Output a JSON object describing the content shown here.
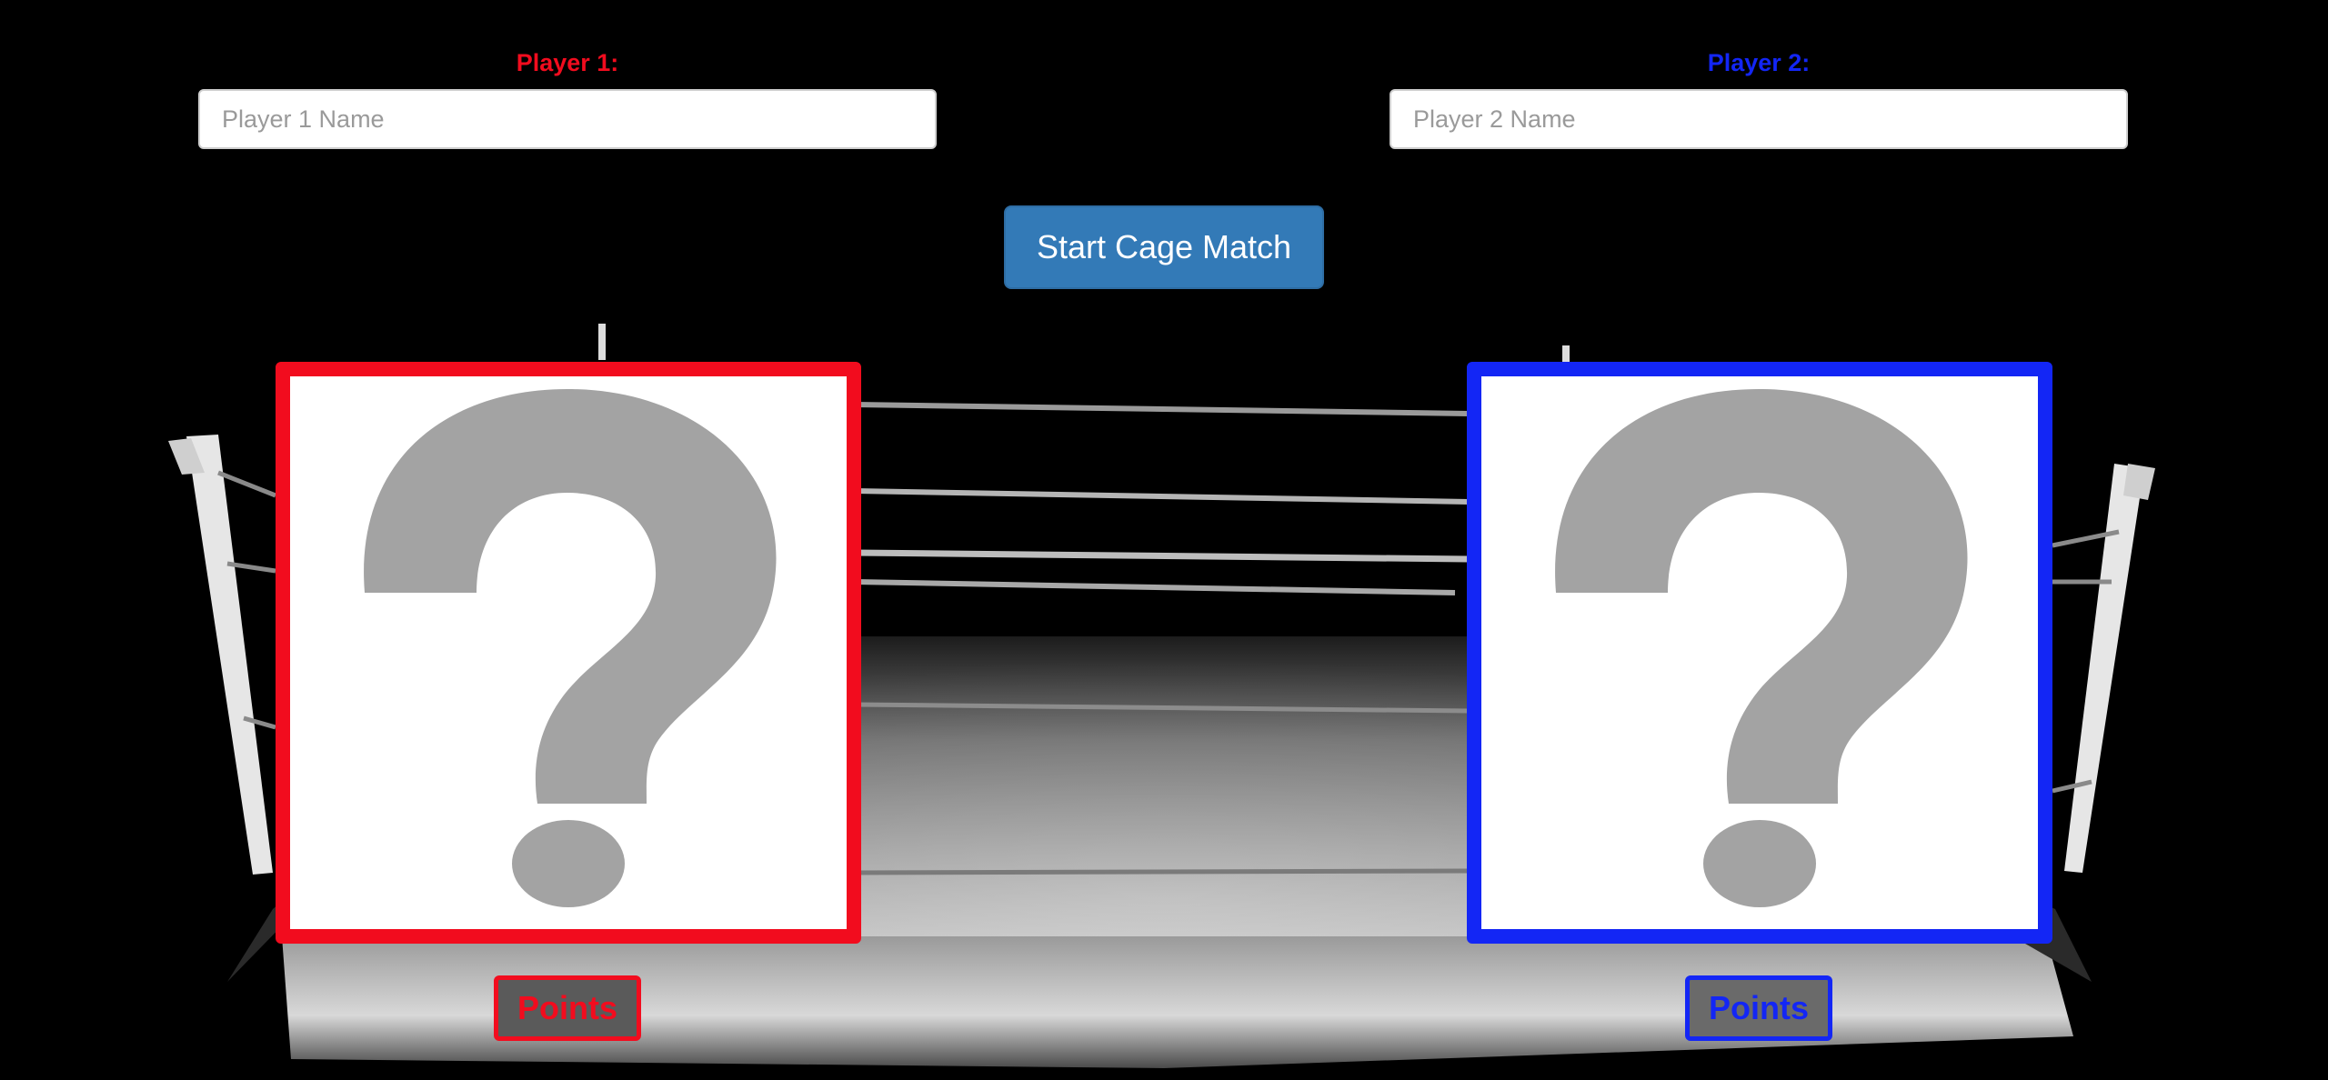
{
  "player1": {
    "label": "Player 1:",
    "name_placeholder": "Player 1 Name",
    "name_value": "",
    "points_label": "Points",
    "color": "#f20c1e"
  },
  "player2": {
    "label": "Player 2:",
    "name_placeholder": "Player 2 Name",
    "name_value": "",
    "points_label": "Points",
    "color": "#1326f5"
  },
  "start_button": {
    "label": "Start Cage Match",
    "color": "#337ab7"
  },
  "fighter_image": {
    "icon": "question-mark-icon"
  },
  "background": {
    "icon": "boxing-ring-image"
  }
}
